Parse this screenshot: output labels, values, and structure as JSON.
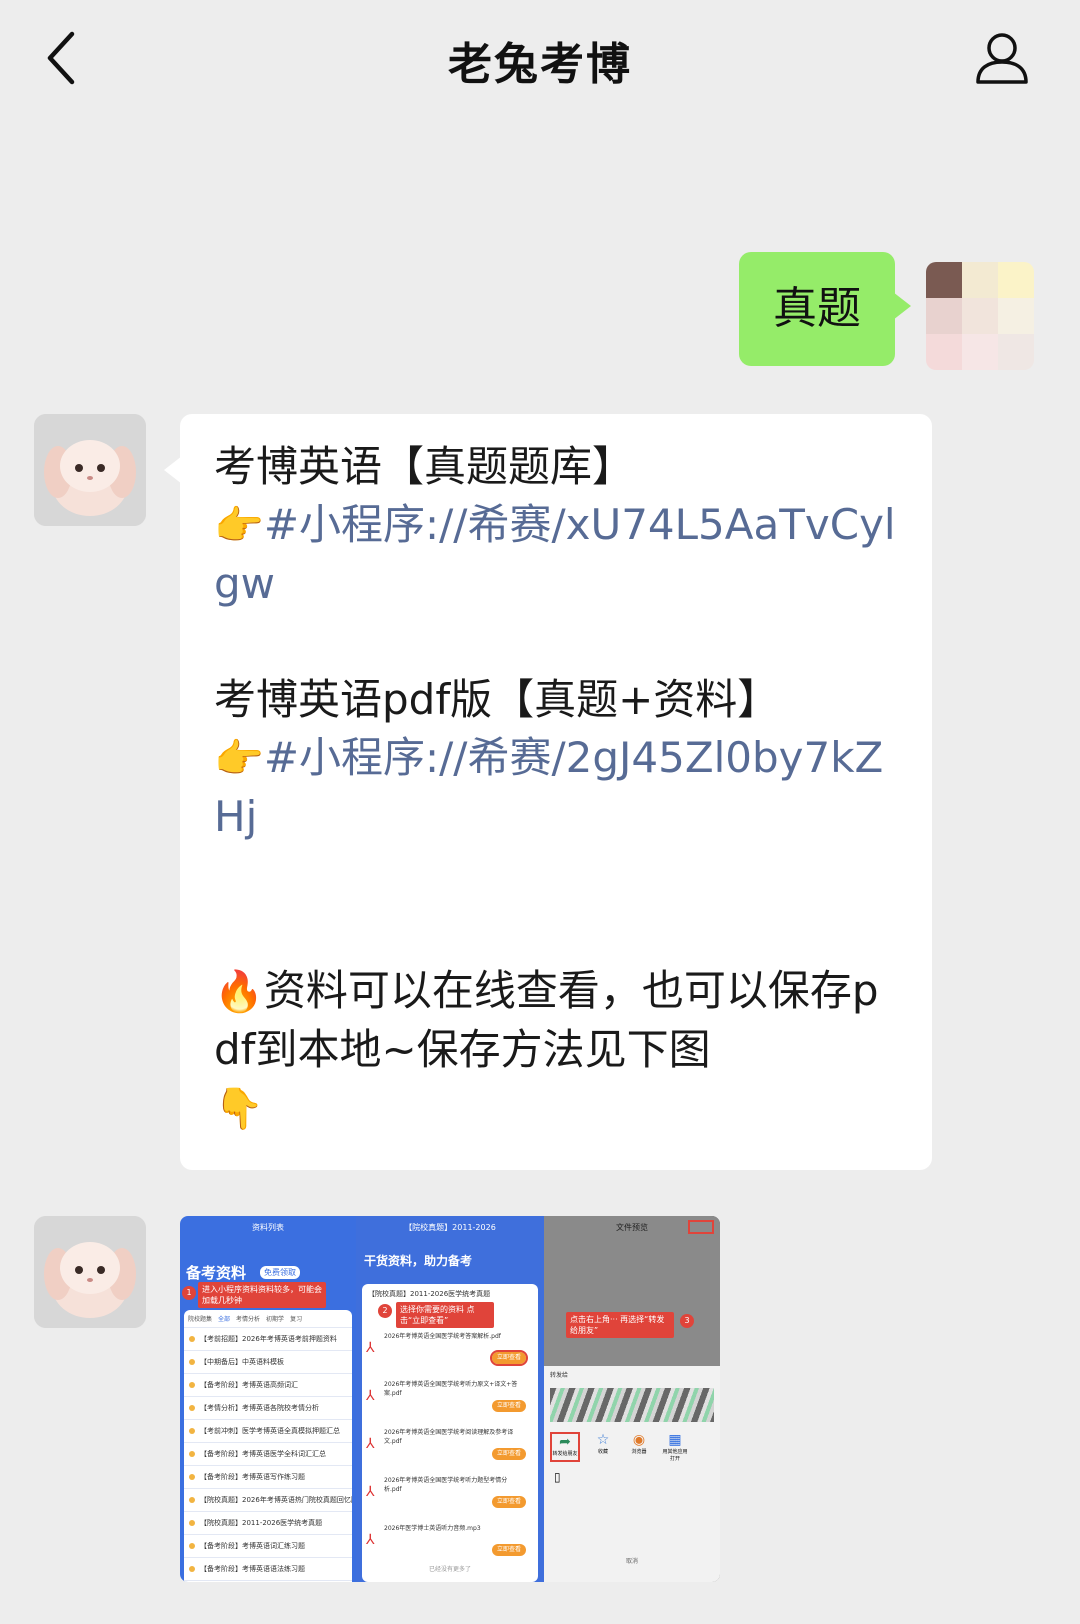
{
  "header": {
    "title": "老兔考博"
  },
  "chat": {
    "my_message": "真题",
    "reply": {
      "line1": "考博英语【真题题库】",
      "link1_emoji": "👉",
      "link1": "#小程序://希赛/xU74L5AaTvCylgw",
      "line2": "考博英语pdf版【真题+资料】",
      "link2_emoji": "👉",
      "link2": "#小程序://希赛/2gJ45Zl0by7kZHj",
      "fire_emoji": "🔥",
      "note": "资料可以在线查看，也可以保存pdf到本地~保存方法见下图",
      "point_emoji": "👇"
    }
  },
  "screenshot": {
    "p1": {
      "nav_title": "资料列表",
      "banner": "备考资料",
      "banner_tag": "免费领取",
      "step1": "进入小程序资料资料较多，可能会加载几秒钟",
      "step1_num": "1",
      "tabs": [
        "院校题集",
        "全部",
        "考情分析",
        "初期学",
        "复习"
      ],
      "items": [
        "【考前招题】2026年考博英语考前押题资料",
        "【中期备后】中英语料模板",
        "【备考阶段】考博英语高频词汇",
        "【考情分析】考博英语各院校考情分析",
        "【考前冲刺】医学考博英语全真模拟押题汇总",
        "【备考阶段】考博英语医学全科词汇汇总",
        "【备考阶段】考博英语写作练习题",
        "【院校真题】2026年考博英语热门院校真题回忆版",
        "【院校真题】2011-2026医学统考真题",
        "【备考阶段】考博英语词汇练习题",
        "【备考阶段】考博英语语法练习题"
      ]
    },
    "p2": {
      "nav_title": "【院校真题】2011-2026",
      "banner": "干货资料，助力备考",
      "card_title": "【院校真题】2011-2026医学统考真题",
      "step2": "选择你需要的资料 点击“立即查看”",
      "step2_num": "2",
      "btn": "立即查看",
      "files": [
        "2026年考博英语全国医学统考答案解析.pdf",
        "2026年考博英语全国医学统考听力原文+译文+答案.pdf",
        "2026年考博英语全国医学统考阅读理解及参考译文.pdf",
        "2026年考博英语全国医学统考听力题型考情分析.pdf",
        "2026年医学博士英语听力音频.mp3"
      ],
      "footer": "已经没有更多了"
    },
    "p3": {
      "nav_title": "文件预览",
      "step3": "点击右上角··· 再选择“转发给朋友”",
      "step3_num": "3",
      "share_label": "转发给",
      "cancel": "取消",
      "actions": [
        "转发给朋友",
        "收藏",
        "浏览器",
        "用其他应用打开"
      ],
      "colors": {
        "accent": "#e0443a"
      }
    }
  }
}
